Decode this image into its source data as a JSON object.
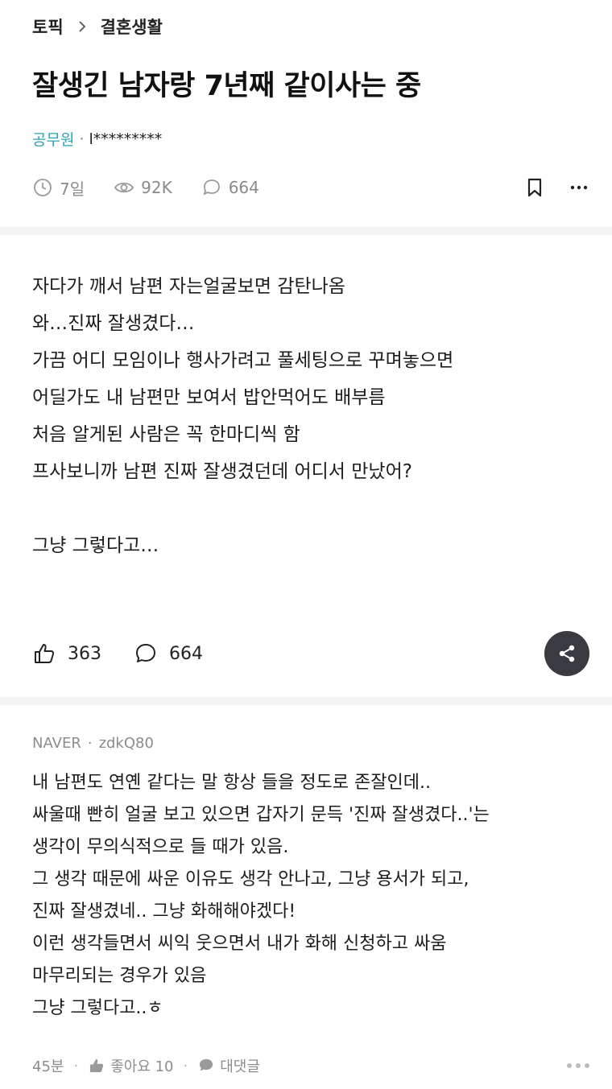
{
  "breadcrumb": {
    "topic": "토픽",
    "category": "결혼생활"
  },
  "post": {
    "title": "잘생긴 남자랑 7년째 같이사는 중",
    "author_company": "공무원",
    "author_sep": "·",
    "author_name": "l*********",
    "time": "7일",
    "views": "92K",
    "comments": "664",
    "body_lines": [
      "자다가 깨서 남편 자는얼굴보면 감탄나옴",
      "와…진짜 잘생겼다…",
      "가끔 어디 모임이나 행사가려고 풀세팅으로 꾸며놓으면",
      "어딜가도 내 남편만 보여서 밥안먹어도 배부름",
      "처음 알게된 사람은 꼭 한마디씩 함",
      "프사보니까 남편 진짜 잘생겼던데 어디서 만났어?",
      "",
      "그냥 그렇다고…"
    ],
    "likes": "363",
    "comment_count": "664"
  },
  "comment": {
    "company": "NAVER",
    "sep": "·",
    "author": "zdkQ80",
    "lines": [
      "내 남편도 연옌 같다는 말 항상 들을 정도로 존잘인데..",
      "싸울때 빤히 얼굴 보고 있으면 갑자기 문득 '진짜 잘생겼다..'는",
      "생각이 무의식적으로 들 때가 있음.",
      "그 생각 때문에 싸운 이유도 생각 안나고, 그냥 용서가 되고,",
      "진짜 잘생겼네.. 그냥 화해해야겠다!",
      "이런 생각들면서 씨익 웃으면서 내가 화해 신청하고 싸움",
      "마무리되는 경우가 있음",
      "그냥 그렇다고..ㅎ"
    ],
    "time": "45분",
    "like_label": "좋아요 10",
    "reply_label": "대댓글"
  },
  "colors": {
    "company_accent": "#2aa3b3",
    "muted": "#8a8a8a",
    "share_bg": "#3a3b40",
    "divider": "#f2f3f5"
  },
  "icons": [
    "chevron-right-icon",
    "clock-icon",
    "eye-icon",
    "comment-bubble-icon",
    "bookmark-icon",
    "more-icon",
    "thumbs-up-icon",
    "share-icon"
  ]
}
